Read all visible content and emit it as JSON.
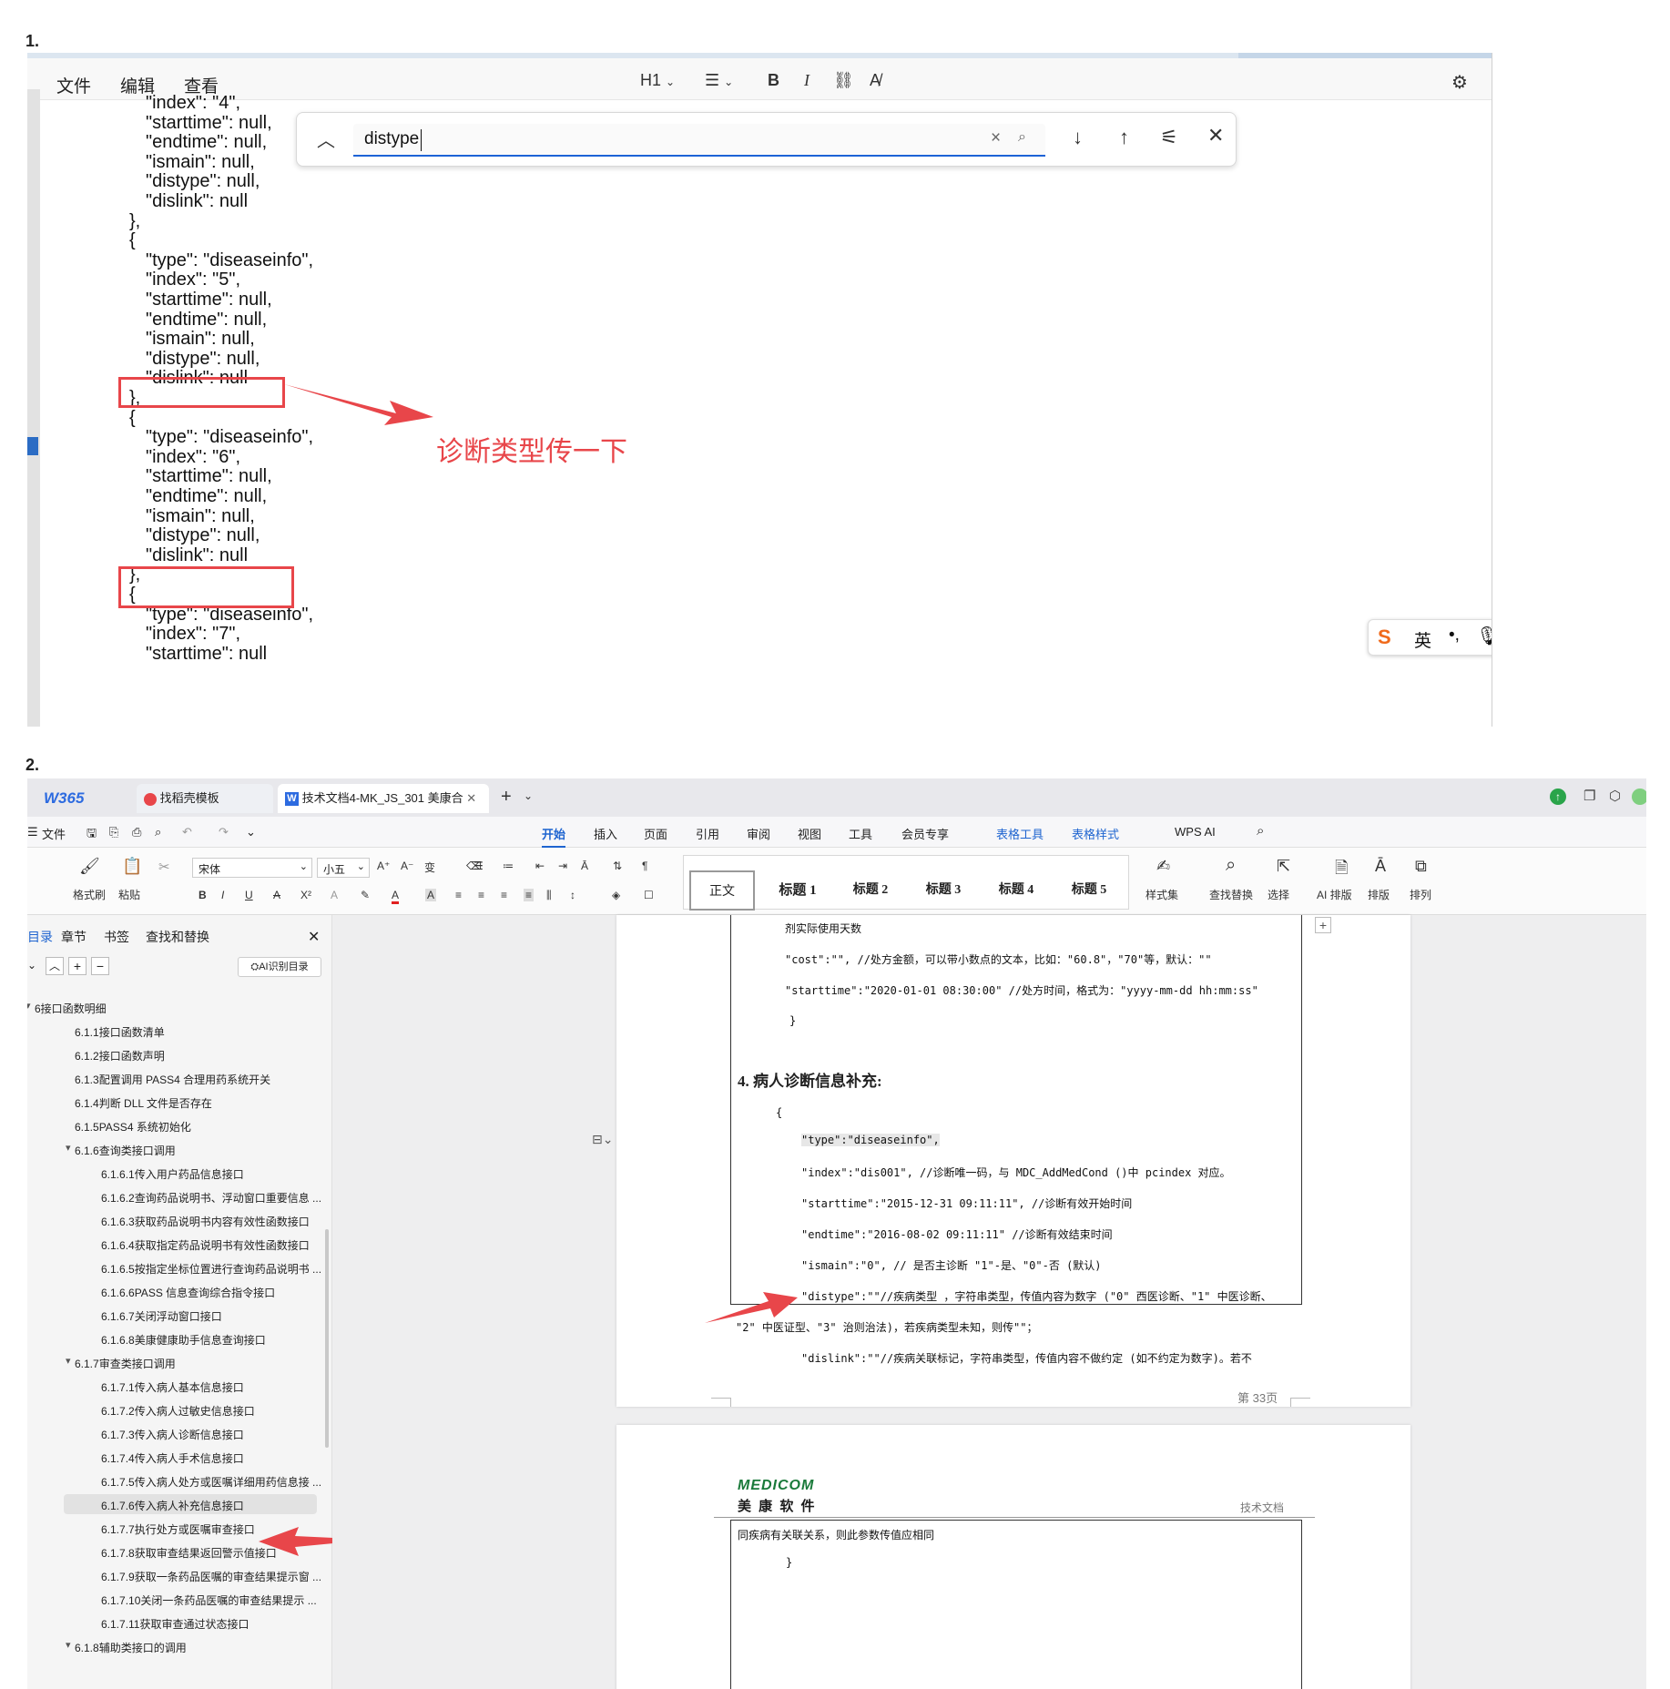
{
  "labels": {
    "one": "1.",
    "two": "2."
  },
  "shot1": {
    "menu": [
      "文件",
      "编辑",
      "查看"
    ],
    "toolbar": {
      "heading": "H1",
      "bold": "B",
      "italic": "I"
    },
    "code": [
      "\"index\": \"4\",",
      "\"starttime\": null,",
      "\"endtime\": null,",
      "\"ismain\": null,",
      "\"distype\": null,",
      "\"dislink\": null",
      "},",
      "{",
      "\"type\": \"diseaseinfo\",",
      "\"index\": \"5\",",
      "\"starttime\": null,",
      "\"endtime\": null,",
      "\"ismain\": null,",
      "\"distype\": null,",
      "\"dislink\": null",
      "},",
      "{",
      "\"type\": \"diseaseinfo\",",
      "\"index\": \"6\",",
      "\"starttime\": null,",
      "\"endtime\": null,",
      "\"ismain\": null,",
      "\"distype\": null,",
      "\"dislink\": null",
      "},",
      "{",
      "\"type\": \"diseaseinfo\",",
      "\"index\": \"7\",",
      "\"starttime\": null"
    ],
    "find": {
      "query": "distype"
    },
    "annotation": "诊断类型传一下",
    "ime": {
      "lang": "英"
    },
    "colors": {
      "annotation": "#e8464a",
      "find_underline": "#1d63d6"
    }
  },
  "shot2": {
    "tabs": [
      {
        "label": "W365"
      },
      {
        "label": "找稻壳模板"
      },
      {
        "label": "技术文档4-MK_JS_301 美康合"
      }
    ],
    "menu": {
      "file": "文件",
      "items": [
        "开始",
        "插入",
        "页面",
        "引用",
        "审阅",
        "视图",
        "工具",
        "会员专享",
        "表格工具",
        "表格样式",
        "WPS AI"
      ],
      "active": "开始"
    },
    "ribbon": {
      "format_painter": "格式刷",
      "paste": "粘贴",
      "font": "宋体",
      "size": "小五",
      "styles": [
        "正文",
        "标题 1",
        "标题 2",
        "标题 3",
        "标题 4",
        "标题 5"
      ],
      "style_set": "样式集",
      "find_replace": "查找替换",
      "select": "选择",
      "ai_layout": "AI 排版",
      "layout": "排版",
      "arrange": "排列"
    },
    "nav": {
      "tabs": [
        "目录",
        "章节",
        "书签",
        "查找和替换"
      ],
      "ai_button": "AI识别目录",
      "toc": [
        {
          "text": "6接口函数明细",
          "level": 0
        },
        {
          "text": "6.1.1接口函数清单",
          "level": 1
        },
        {
          "text": "6.1.2接口函数声明",
          "level": 1
        },
        {
          "text": "6.1.3配置调用 PASS4 合理用药系统开关",
          "level": 1
        },
        {
          "text": "6.1.4判断 DLL 文件是否存在",
          "level": 1
        },
        {
          "text": "6.1.5PASS4 系统初始化",
          "level": 1
        },
        {
          "text": "6.1.6查询类接口调用",
          "level": 1
        },
        {
          "text": "6.1.6.1传入用户药品信息接口",
          "level": 2
        },
        {
          "text": "6.1.6.2查询药品说明书、浮动窗口重要信息 ...",
          "level": 2
        },
        {
          "text": "6.1.6.3获取药品说明书内容有效性函数接口",
          "level": 2
        },
        {
          "text": "6.1.6.4获取指定药品说明书有效性函数接口",
          "level": 2
        },
        {
          "text": "6.1.6.5按指定坐标位置进行查询药品说明书 ...",
          "level": 2
        },
        {
          "text": "6.1.6.6PASS 信息查询综合指令接口",
          "level": 2
        },
        {
          "text": "6.1.6.7关闭浮动窗口接口",
          "level": 2
        },
        {
          "text": "6.1.6.8美康健康助手信息查询接口",
          "level": 2
        },
        {
          "text": "6.1.7审查类接口调用",
          "level": 1
        },
        {
          "text": "6.1.7.1传入病人基本信息接口",
          "level": 2
        },
        {
          "text": "6.1.7.2传入病人过敏史信息接口",
          "level": 2
        },
        {
          "text": "6.1.7.3传入病人诊断信息接口",
          "level": 2
        },
        {
          "text": "6.1.7.4传入病人手术信息接口",
          "level": 2
        },
        {
          "text": "6.1.7.5传入病人处方或医嘱详细用药信息接 ...",
          "level": 2
        },
        {
          "text": "6.1.7.6传入病人补充信息接口",
          "level": 2
        },
        {
          "text": "6.1.7.7执行处方或医嘱审查接口",
          "level": 2
        },
        {
          "text": "6.1.7.8获取审查结果返回警示值接口",
          "level": 2
        },
        {
          "text": "6.1.7.9获取一条药品医嘱的审查结果提示窗 ...",
          "level": 2
        },
        {
          "text": "6.1.7.10关闭一条药品医嘱的审查结果提示 ...",
          "level": 2
        },
        {
          "text": "6.1.7.11获取审查通过状态接口",
          "level": 2
        },
        {
          "text": "6.1.8辅助类接口的调用",
          "level": 1
        }
      ],
      "selected": "6.1.7.6传入病人补充信息接口"
    },
    "doc": {
      "lines_top": [
        "剂实际使用天数",
        "\"cost\":\"\", //处方金额，可以带小数点的文本，比如：\"60.8\"，\"70\"等，默认：\"\"",
        "\"starttime\":\"2020-01-01 08:30:00\" //处方时间，格式为：\"yyyy-mm-dd hh:mm:ss\"",
        "}"
      ],
      "heading": "4.  病人诊断信息补充:",
      "brace": "{",
      "lines": [
        "\"type\":\"diseaseinfo\",",
        "\"index\":\"dis001\", //诊断唯一码，与 MDC_AddMedCond ()中 pcindex 对应。",
        "\"starttime\":\"2015-12-31 09:11:11\", //诊断有效开始时间",
        "\"endtime\":\"2016-08-02 09:11:11\" //诊断有效结束时间",
        "\"ismain\":\"0\", // 是否主诊断 \"1\"-是、\"0\"-否 (默认)",
        "\"distype\":\"\"//疾病类型 ，字符串类型，传值内容为数字 (\"0\" 西医诊断、\"1\" 中医诊断、",
        "\"2\" 中医证型、\"3\" 治则治法)，若疾病类型未知，则传\"\"；",
        "\"dislink\":\"\"//疾病关联标记，字符串类型，传值内容不做约定 (如不约定为数字)。若不"
      ],
      "page_num": "第 33页",
      "logo": "MEDICOM",
      "company": "美 康 软 件",
      "doc_tag": "技术文档",
      "next_page_line": "同疾病有关联关系，则此参数传值应相同",
      "next_brace": "}"
    },
    "colors": {
      "accent": "#1e64d0",
      "arrow": "#e8464a",
      "wps_logo": "#2d6be0"
    }
  }
}
